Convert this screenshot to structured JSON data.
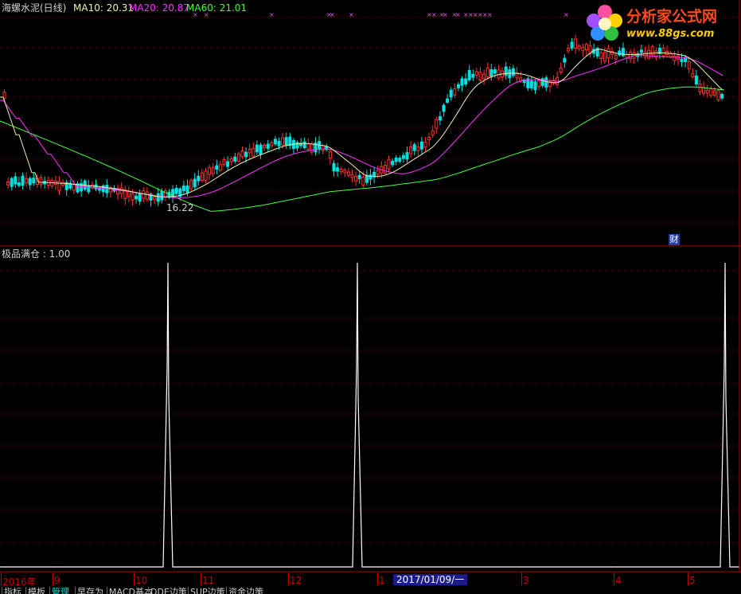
{
  "header": {
    "stock_title": "海螺水泥(日线)",
    "ma10": "MA10: 20.31",
    "ma20": "MA20: 20.87",
    "ma60": "MA60: 21.01"
  },
  "colors": {
    "up": "#ff3030",
    "down": "#00e0e0",
    "ma10": "#f0f0b0",
    "ma20": "#ff30ff",
    "ma60": "#40ff40",
    "grid": "#8a0000",
    "signal": "#ffffff",
    "marker": "#ff40ff"
  },
  "main_chart": {
    "low_label": "16.22",
    "finance_badge": "财"
  },
  "indicator": {
    "label": "极品满仓 : 1.00"
  },
  "logo": {
    "name": "分析家公式网",
    "url": "www.88gs.com"
  },
  "time_axis": {
    "ticks": [
      "2016年",
      "9",
      "10",
      "11",
      "12",
      "1",
      "3",
      "4",
      "5"
    ],
    "current_date": "2017/01/09/一"
  },
  "tabs": [
    "指标",
    "模板",
    "管理",
    "早存为",
    "MACD基本",
    "DDE边策",
    "SUP边策",
    "资金边策"
  ],
  "active_tab": 2
}
